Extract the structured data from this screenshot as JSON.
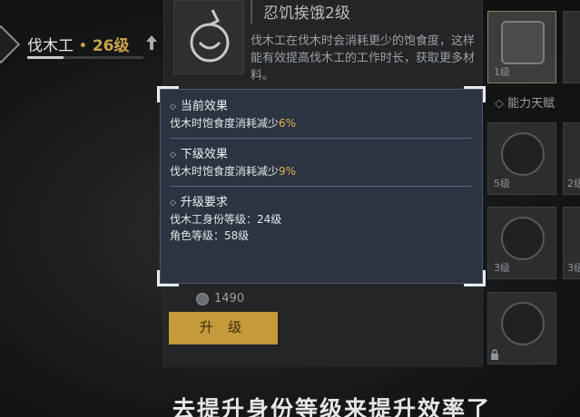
{
  "profession": {
    "name": "伐木工",
    "separator": "•",
    "level": "26级"
  },
  "skill": {
    "name": "忍饥挨饿2级",
    "description": "伐木工在伐木时会消耗更少的饱食度，这样能有效提高伐木工的工作时长，获取更多材料。",
    "cost": "1490",
    "upgrade_label": "升 级"
  },
  "popup": {
    "current": {
      "title": "当前效果",
      "text": "伐木时饱食度消耗减少",
      "value": "6%"
    },
    "next": {
      "title": "下级效果",
      "text": "伐木时饱食度消耗减少",
      "value": "9%"
    },
    "requirements": {
      "title": "升级要求",
      "lines": [
        "伐木工身份等级：24级",
        "角色等级：58级"
      ]
    }
  },
  "talents": {
    "header": "能力天赋",
    "cards": [
      {
        "level": "1级",
        "icon": "axe-icon"
      },
      {
        "level": "5级",
        "icon": "arm-icon"
      },
      {
        "level": "3级",
        "icon": "saw-icon"
      },
      {
        "level": "",
        "icon": "fist-icon"
      }
    ],
    "peek_levels": [
      "",
      "2级",
      "3级"
    ]
  },
  "subtitle": "去提升身份等级来提升效率了",
  "colors": {
    "accent_gold": "#c9a24a",
    "highlight": "#e3b34a",
    "button": "#c49a3a",
    "popup_bg": "#2c3442"
  }
}
